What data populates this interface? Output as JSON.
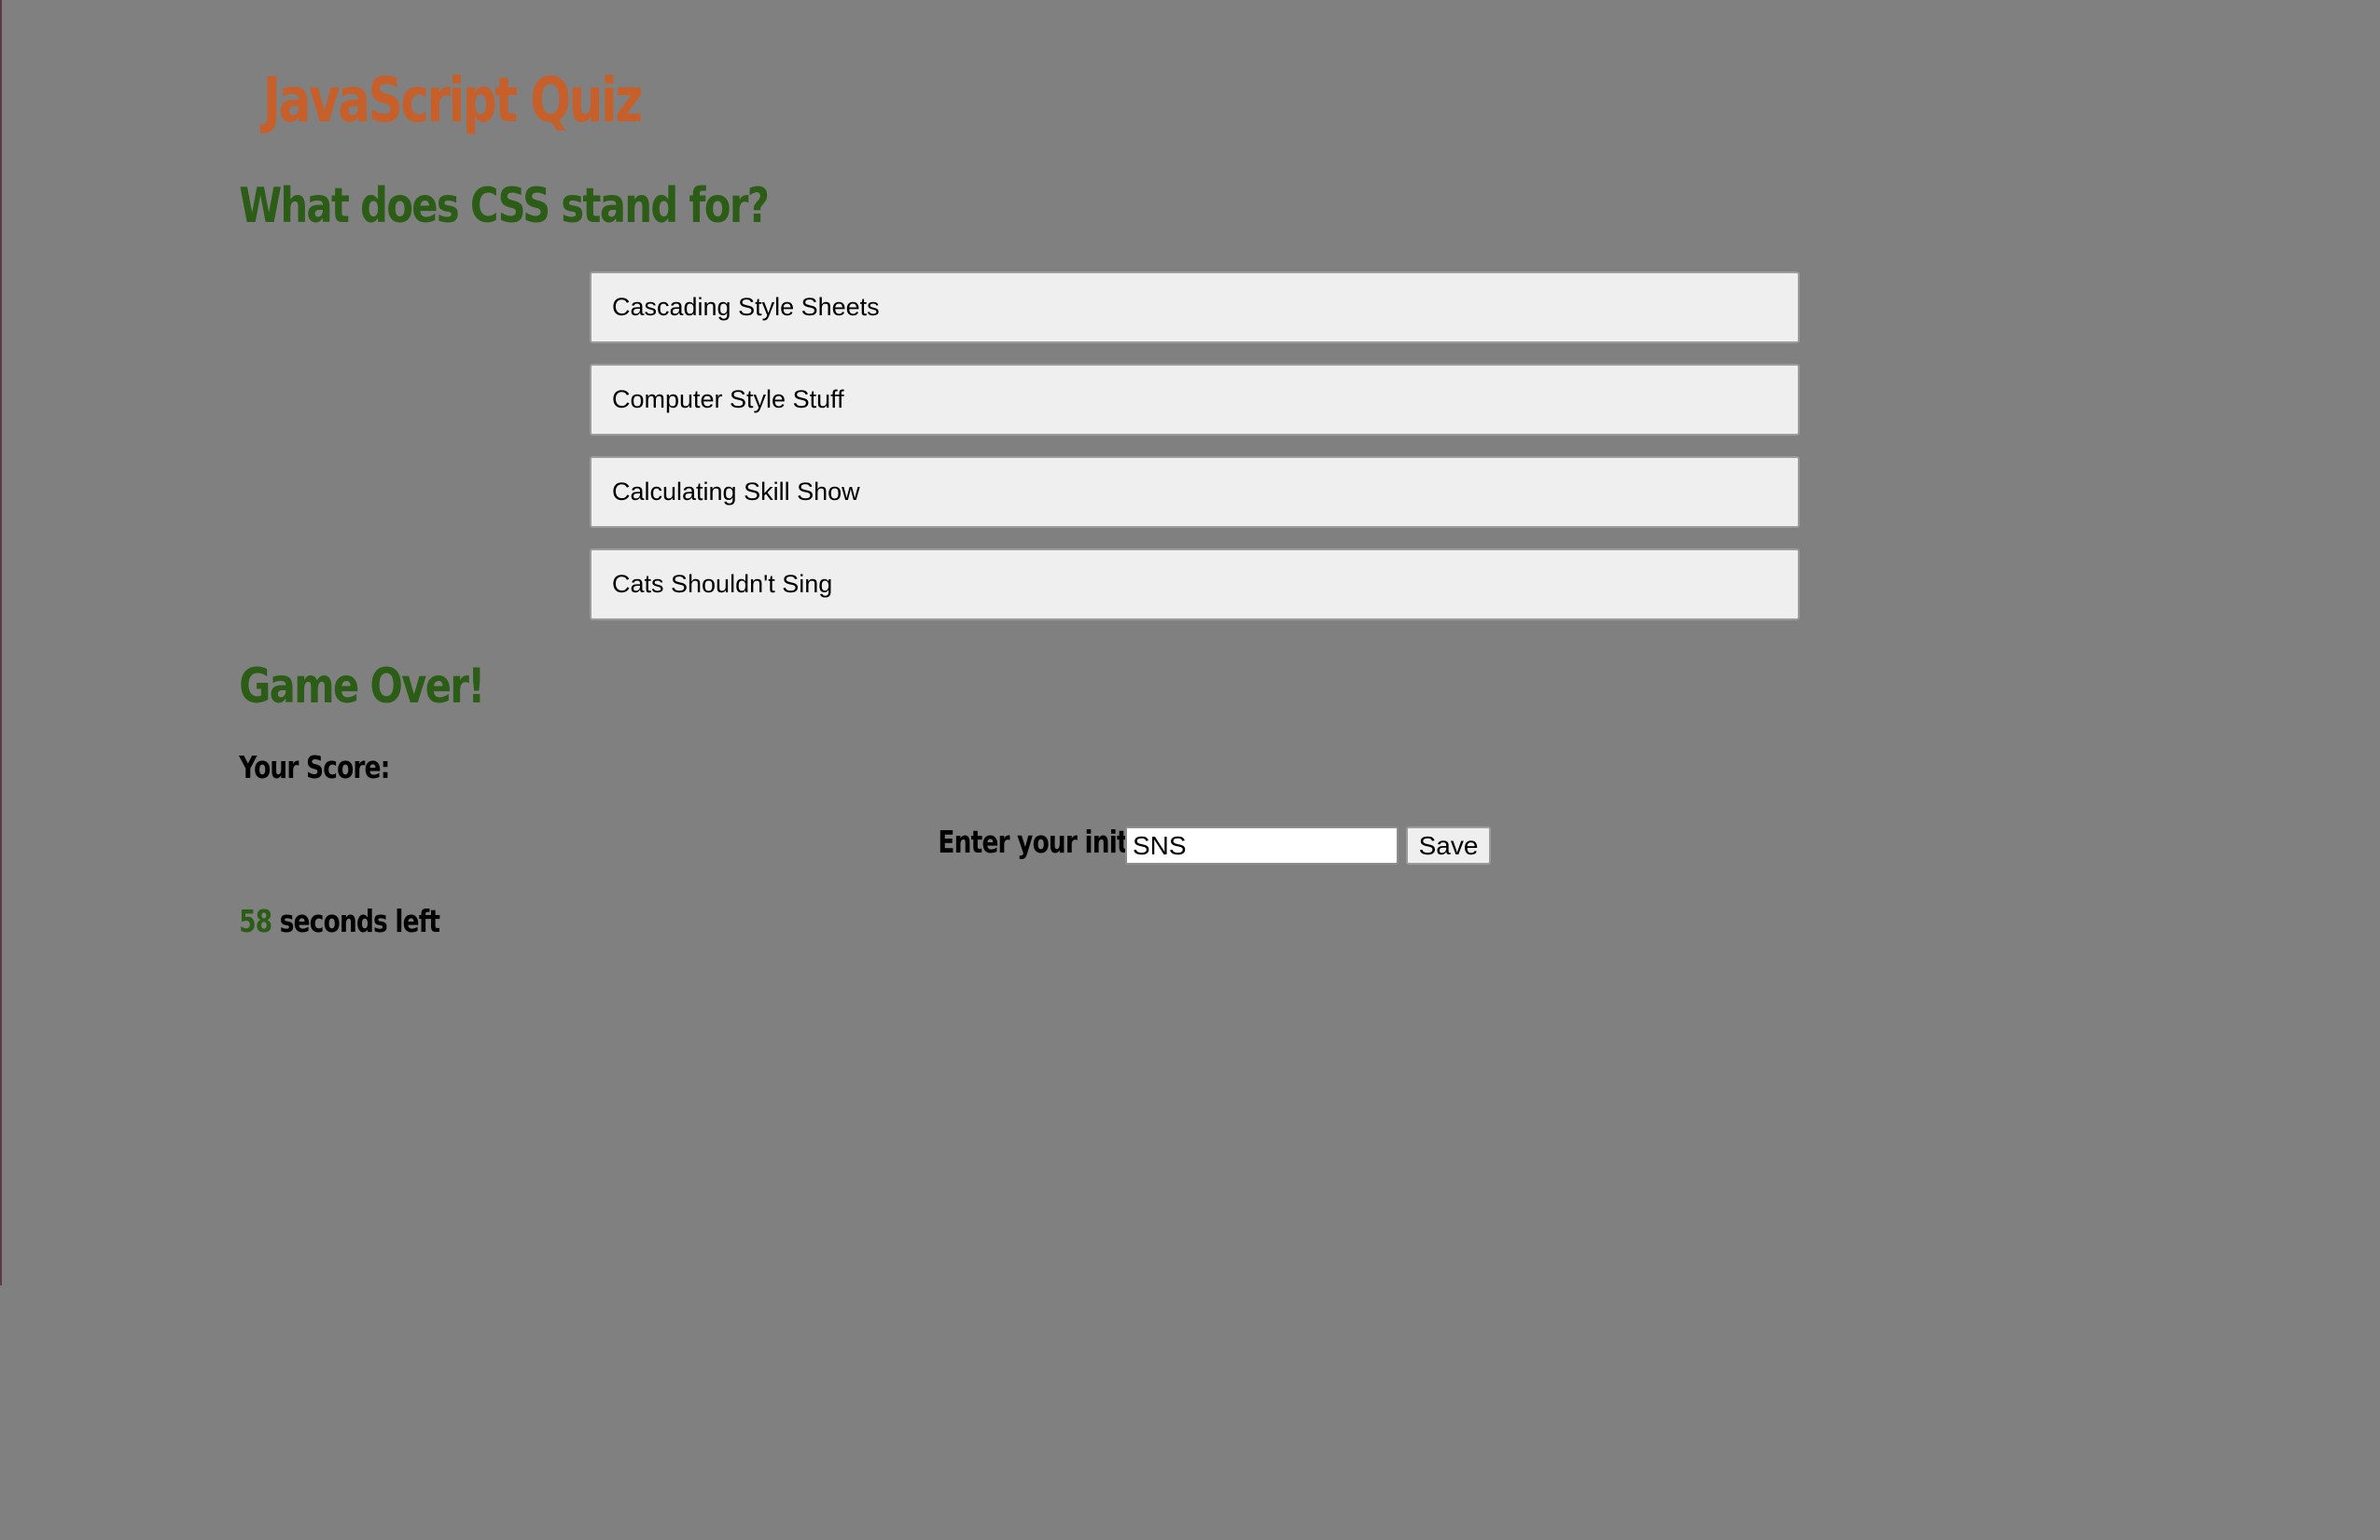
{
  "header": {
    "title": "JavaScript Quiz"
  },
  "quiz": {
    "question": "What does CSS stand for?",
    "choices": [
      "Cascading Style Sheets",
      "Computer Style Stuff",
      "Calculating Skill Show",
      "Cats Shouldn't Sing"
    ]
  },
  "results": {
    "heading": "Game Over!",
    "score_label": "Your Score:",
    "initials_label": "Enter your initials:",
    "initials_value": "SNS",
    "save_label": "Save"
  },
  "timer": {
    "seconds": "58",
    "suffix": "seconds left"
  },
  "colors": {
    "background": "#808080",
    "title": "#c65f2a",
    "accent_green": "#2c5d16",
    "button_bg": "#efefef"
  }
}
